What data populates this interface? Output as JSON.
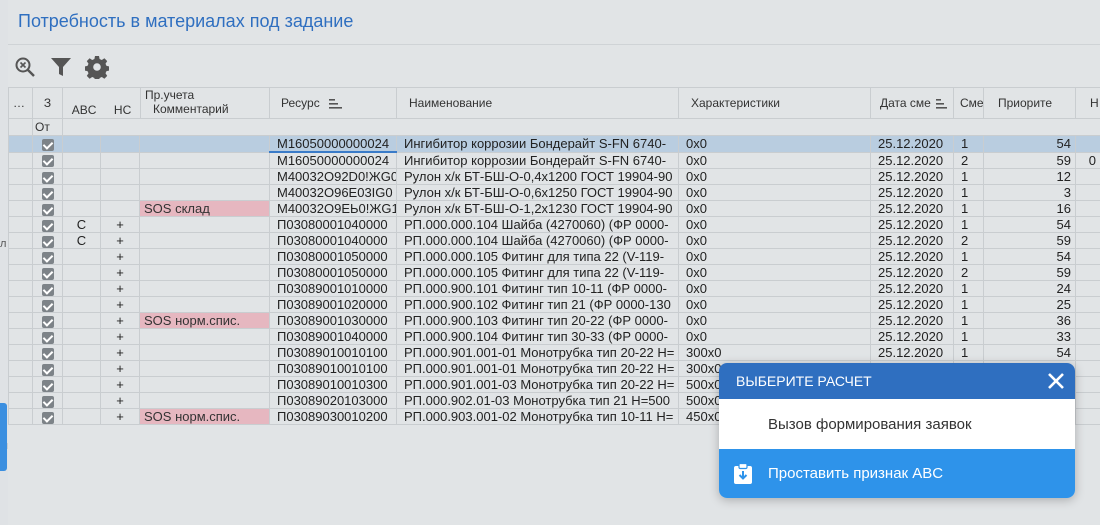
{
  "title": "Потребность в материалах под задание",
  "side": {
    "frag1": "л",
    "frag2": "ы"
  },
  "columns": {
    "z": "З",
    "from": "От",
    "abc": "ABC",
    "hc": "НС",
    "account_group": "Пр.учета",
    "comment": "Комментарий",
    "resource": "Ресурс",
    "name": "Наименование",
    "characteristics": "Характеристики",
    "date": "Дата сме",
    "shift": "Смен",
    "priority": "Приорите",
    "extra": "Н",
    "dots": "…"
  },
  "rows": [
    {
      "abc": "",
      "hc": "",
      "comment": "",
      "resource": "М16050000000024",
      "name": "Ингибитор коррозии Бондерайт S-FN 6740-",
      "char": "0x0",
      "date": "25.12.2020",
      "shift": "1",
      "priority": "54",
      "extra": "",
      "sos": false,
      "selected": true
    },
    {
      "abc": "",
      "hc": "",
      "comment": "",
      "resource": "М16050000000024",
      "name": "Ингибитор коррозии Бондерайт S-FN 6740-",
      "char": "0x0",
      "date": "25.12.2020",
      "shift": "2",
      "priority": "59",
      "extra": "0",
      "sos": false,
      "selected": false
    },
    {
      "abc": "",
      "hc": "",
      "comment": "",
      "resource": "М40032О92D0!ЖG0",
      "name": "Рулон х/к БТ-БШ-О-0,4x1200 ГОСТ 19904-90",
      "char": "0x0",
      "date": "25.12.2020",
      "shift": "1",
      "priority": "12",
      "extra": "",
      "sos": false,
      "selected": false
    },
    {
      "abc": "",
      "hc": "",
      "comment": "",
      "resource": "М40032О96Е03IG0",
      "name": "Рулон х/к БТ-БШ-О-0,6x1250 ГОСТ 19904-90",
      "char": "0x0",
      "date": "25.12.2020",
      "shift": "1",
      "priority": "3",
      "extra": "",
      "sos": false,
      "selected": false
    },
    {
      "abc": "",
      "hc": "",
      "comment": "SOS склад",
      "resource": "М40032О9ЕЬ0!ЖG1",
      "name": "Рулон х/к БТ-БШ-О-1,2x1230 ГОСТ 19904-90",
      "char": "0x0",
      "date": "25.12.2020",
      "shift": "1",
      "priority": "16",
      "extra": "",
      "sos": true,
      "selected": false
    },
    {
      "abc": "С",
      "hc": "+",
      "comment": "",
      "resource": "П03080001040000",
      "name": "РП.000.000.104 Шайба (4270060) (ФР 0000-",
      "char": "0x0",
      "date": "25.12.2020",
      "shift": "1",
      "priority": "54",
      "extra": "",
      "sos": false,
      "selected": false
    },
    {
      "abc": "С",
      "hc": "+",
      "comment": "",
      "resource": "П03080001040000",
      "name": "РП.000.000.104 Шайба (4270060) (ФР 0000-",
      "char": "0x0",
      "date": "25.12.2020",
      "shift": "2",
      "priority": "59",
      "extra": "",
      "sos": false,
      "selected": false
    },
    {
      "abc": "",
      "hc": "+",
      "comment": "",
      "resource": "П03080001050000",
      "name": "РП.000.000.105 Фитинг для типа 22 (V-119-",
      "char": "0x0",
      "date": "25.12.2020",
      "shift": "1",
      "priority": "54",
      "extra": "",
      "sos": false,
      "selected": false
    },
    {
      "abc": "",
      "hc": "+",
      "comment": "",
      "resource": "П03080001050000",
      "name": "РП.000.000.105 Фитинг для типа 22 (V-119-",
      "char": "0x0",
      "date": "25.12.2020",
      "shift": "2",
      "priority": "59",
      "extra": "",
      "sos": false,
      "selected": false
    },
    {
      "abc": "",
      "hc": "+",
      "comment": "",
      "resource": "П03089001010000",
      "name": "РП.000.900.101 Фитинг тип 10-11 (ФР 0000-",
      "char": "0x0",
      "date": "25.12.2020",
      "shift": "1",
      "priority": "24",
      "extra": "",
      "sos": false,
      "selected": false
    },
    {
      "abc": "",
      "hc": "+",
      "comment": "",
      "resource": "П03089001020000",
      "name": "РП.000.900.102 Фитинг тип 21 (ФР 0000-130",
      "char": "0x0",
      "date": "25.12.2020",
      "shift": "1",
      "priority": "25",
      "extra": "",
      "sos": false,
      "selected": false
    },
    {
      "abc": "",
      "hc": "+",
      "comment": "SOS норм.спис.",
      "resource": "П03089001030000",
      "name": "РП.000.900.103 Фитинг тип 20-22 (ФР 0000-",
      "char": "0x0",
      "date": "25.12.2020",
      "shift": "1",
      "priority": "36",
      "extra": "",
      "sos": true,
      "selected": false
    },
    {
      "abc": "",
      "hc": "+",
      "comment": "",
      "resource": "П03089001040000",
      "name": "РП.000.900.104 Фитинг тип 30-33 (ФР 0000-",
      "char": "0x0",
      "date": "25.12.2020",
      "shift": "1",
      "priority": "33",
      "extra": "",
      "sos": false,
      "selected": false
    },
    {
      "abc": "",
      "hc": "+",
      "comment": "",
      "resource": "П03089010010100",
      "name": "РП.000.901.001-01 Монотрубка тип 20-22 H=",
      "char": "300x0",
      "date": "25.12.2020",
      "shift": "1",
      "priority": "54",
      "extra": "",
      "sos": false,
      "selected": false
    },
    {
      "abc": "",
      "hc": "+",
      "comment": "",
      "resource": "П03089010010100",
      "name": "РП.000.901.001-01 Монотрубка тип 20-22 H=",
      "char": "300x0",
      "date": "",
      "shift": "",
      "priority": "",
      "extra": "",
      "sos": false,
      "selected": false
    },
    {
      "abc": "",
      "hc": "+",
      "comment": "",
      "resource": "П03089010010300",
      "name": "РП.000.901.001-03 Монотрубка тип 20-22 H=",
      "char": "500x0",
      "date": "",
      "shift": "",
      "priority": "",
      "extra": "",
      "sos": false,
      "selected": false
    },
    {
      "abc": "",
      "hc": "+",
      "comment": "",
      "resource": "П03089020103000",
      "name": "РП.000.902.01-03 Монотрубка тип 21 H=500",
      "char": "500x0",
      "date": "",
      "shift": "",
      "priority": "",
      "extra": "",
      "sos": false,
      "selected": false
    },
    {
      "abc": "",
      "hc": "+",
      "comment": "SOS норм.спис.",
      "resource": "П03089030010200",
      "name": "РП.000.903.001-02 Монотрубка тип 10-11 H=",
      "char": "450x0",
      "date": "",
      "shift": "",
      "priority": "",
      "extra": "",
      "sos": true,
      "selected": false
    }
  ],
  "dialog": {
    "title": "ВЫБЕРИТЕ РАСЧЕТ",
    "item1": "Вызов формирования заявок",
    "item2": "Проставить признак ABC"
  },
  "colors": {
    "accent": "#2f6fc0",
    "highlight": "#2e93ea",
    "sos": "#e6b7c0",
    "selected": "#b9cde0"
  },
  "icons": [
    "zoom-reset-icon",
    "filter-icon",
    "gear-icon",
    "sort-icon",
    "close-icon",
    "clipboard-download-icon",
    "checkbox-icon"
  ]
}
